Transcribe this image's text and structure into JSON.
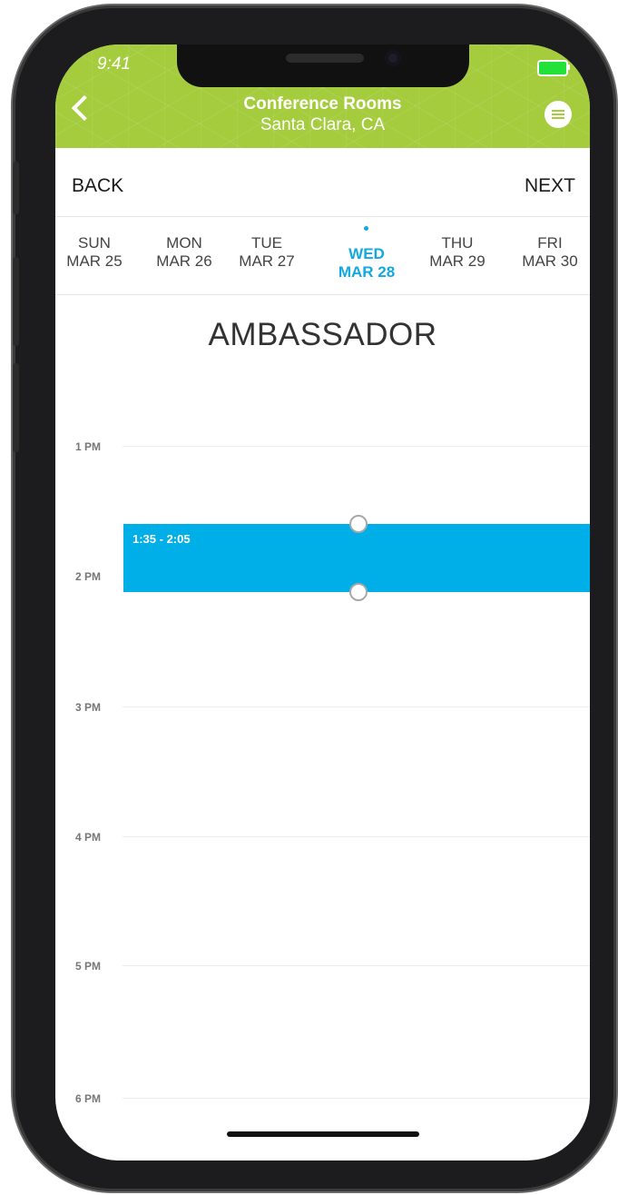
{
  "status_bar": {
    "time": "9:41"
  },
  "header": {
    "title": "Conference Rooms",
    "subtitle": "Santa Clara, CA"
  },
  "nav": {
    "back_label": "BACK",
    "next_label": "NEXT"
  },
  "days": [
    {
      "dow": "SUN",
      "date": "MAR 25"
    },
    {
      "dow": "MON",
      "date": "MAR 26"
    },
    {
      "dow": "TUE",
      "date": "MAR 27"
    },
    {
      "dow": "WED",
      "date": "MAR 28"
    },
    {
      "dow": "THU",
      "date": "MAR 29"
    },
    {
      "dow": "FRI",
      "date": "MAR 30"
    }
  ],
  "room": {
    "name": "AMBASSADOR"
  },
  "timeline": {
    "hours": [
      "1 PM",
      "2 PM",
      "3 PM",
      "4 PM",
      "5 PM",
      "6 PM"
    ]
  },
  "event": {
    "label": "1:35  - 2:05"
  },
  "colors": {
    "header_green": "#a4cc3d",
    "accent_blue": "#12a9e0",
    "event_blue": "#00aee8",
    "battery_green": "#22e23a"
  },
  "icons": {
    "back": "chevron-left-icon",
    "menu": "hamburger-menu-icon",
    "battery": "battery-icon"
  }
}
